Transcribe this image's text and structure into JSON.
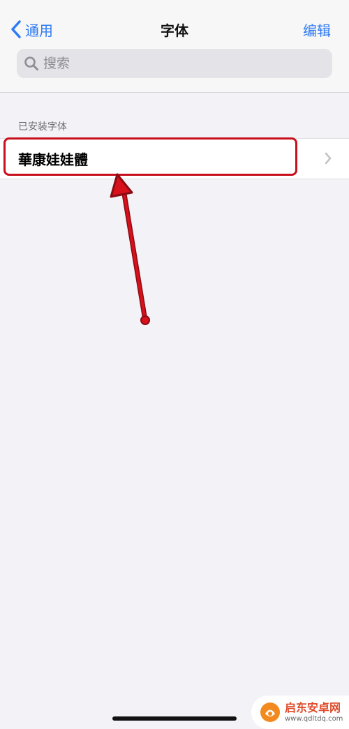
{
  "navbar": {
    "back_label": "通用",
    "title": "字体",
    "edit_label": "编辑"
  },
  "search": {
    "placeholder": "搜索",
    "value": ""
  },
  "section": {
    "header": "已安装字体"
  },
  "fonts": [
    {
      "name": "華康娃娃體"
    }
  ],
  "watermark": {
    "brand": "启东安卓网",
    "url": "www.qdltdq.com"
  },
  "colors": {
    "accent": "#2f7bf6",
    "annotation": "#c8101d",
    "background": "#f2f2f7"
  }
}
